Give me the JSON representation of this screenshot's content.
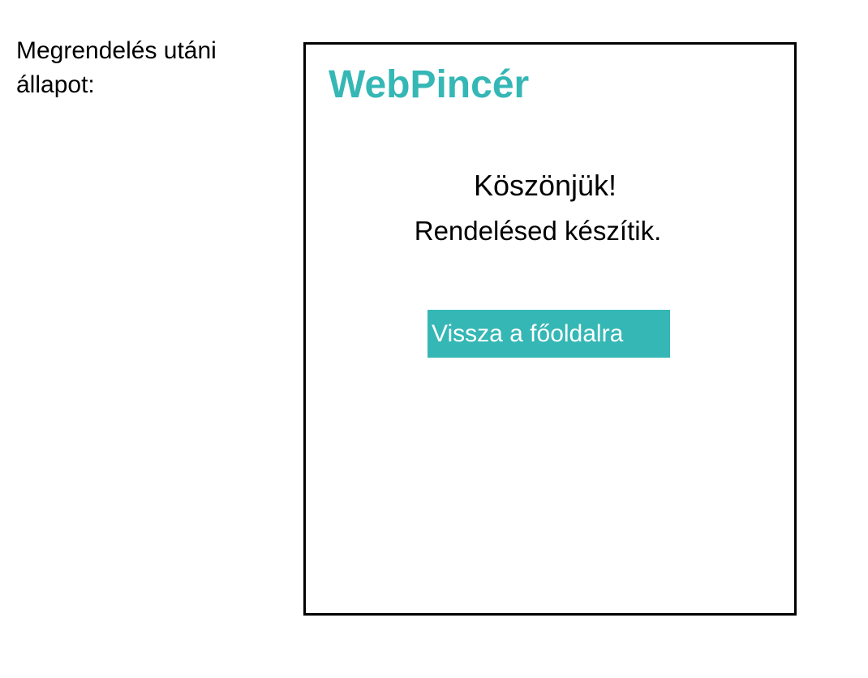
{
  "side_label": {
    "line1": "Megrendelés utáni",
    "line2": "állapot:"
  },
  "mockup": {
    "brand": "WebPincér",
    "thanks": "Köszönjük!",
    "status": "Rendelésed készítik.",
    "back_button_label": "Vissza a főoldalra"
  },
  "colors": {
    "accent": "#35b7b5",
    "text": "#000000",
    "background": "#ffffff"
  }
}
